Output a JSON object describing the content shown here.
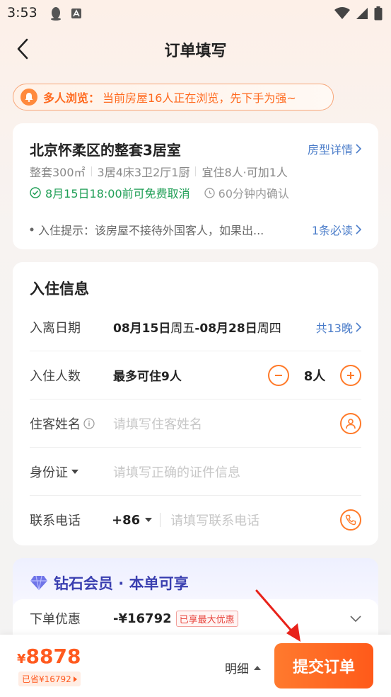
{
  "status_bar": {
    "time": "3:53"
  },
  "header": {
    "title": "订单填写"
  },
  "banner": {
    "tag": "多人浏览：",
    "text": "当前房屋16人正在浏览，先下手为强~"
  },
  "room": {
    "title": "北京怀柔区的整套3居室",
    "detail_link": "房型详情",
    "specs": [
      "整套300㎡",
      "3居4床3卫2厅1厨",
      "宜住8人·可加1人"
    ],
    "cancel_policy": "8月15日18:00前可免费取消",
    "confirm_time": "60分钟内确认",
    "tip": "入住提示：该房屋不接待外国客人，如果出...",
    "tip_link": "1条必读"
  },
  "checkin": {
    "title": "入住信息",
    "dates": {
      "label": "入离日期",
      "start": "08月15日",
      "start_weekday": "周五",
      "separator": "-",
      "end": "08月28日",
      "end_weekday": "周四",
      "nights": "共13晚"
    },
    "guests": {
      "label": "入住人数",
      "max": "最多可住9人",
      "count": "8人"
    },
    "name": {
      "label": "住客姓名",
      "placeholder": "请填写住客姓名"
    },
    "id": {
      "label": "身份证",
      "placeholder": "请填写正确的证件信息"
    },
    "phone": {
      "label": "联系电话",
      "code": "+86",
      "placeholder": "请填写联系电话"
    }
  },
  "vip": {
    "title": "钻石会员 · 本单可享",
    "discount_label": "下单优惠",
    "discount_value": "-¥16792",
    "discount_badge": "已享最大优惠"
  },
  "footer": {
    "currency": "¥",
    "price": "8878",
    "saved": "已省¥16792",
    "detail": "明细",
    "submit": "提交订单"
  },
  "colors": {
    "accent": "#FF6A1F",
    "link": "#4A7CC9",
    "success": "#1E9E55",
    "vip": "#3A3FB0"
  }
}
